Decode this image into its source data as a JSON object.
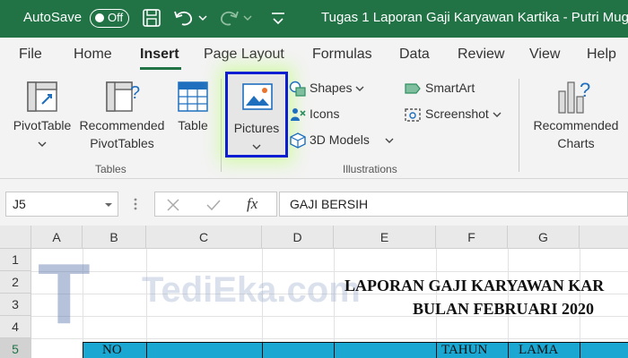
{
  "titlebar": {
    "autosave_label": "AutoSave",
    "autosave_state": "Off",
    "document_title": "Tugas 1 Laporan Gaji Karyawan Kartika - Putri Mugn"
  },
  "tabs": [
    "File",
    "Home",
    "Insert",
    "Page Layout",
    "Formulas",
    "Data",
    "Review",
    "View",
    "Help"
  ],
  "active_tab": "Insert",
  "ribbon": {
    "tables": {
      "pivottable": "PivotTable",
      "recommended_pivot_line1": "Recommended",
      "recommended_pivot_line2": "PivotTables",
      "table": "Table",
      "group_label": "Tables"
    },
    "illustrations": {
      "pictures": "Pictures",
      "shapes": "Shapes",
      "icons": "Icons",
      "models_3d": "3D Models",
      "smartart": "SmartArt",
      "screenshot": "Screenshot",
      "group_label": "Illustrations"
    },
    "charts": {
      "recommended_line1": "Recommended",
      "recommended_line2": "Charts"
    }
  },
  "formula_bar": {
    "name_box": "J5",
    "fx": "fx",
    "formula": "GAJI BERSIH"
  },
  "grid": {
    "columns": [
      "A",
      "B",
      "C",
      "D",
      "E",
      "F",
      "G"
    ],
    "rows": [
      "1",
      "2",
      "3",
      "4",
      "5"
    ],
    "heading_line1": "LAPORAN GAJI KARYAWAN KAR",
    "heading_line2": "BULAN FEBRUARI 2020",
    "header_no": "NO",
    "header_tahun": "TAHUN",
    "header_lama": "LAMA"
  },
  "watermark": {
    "letter": "T",
    "text": "TediEka.com"
  },
  "colors": {
    "titlebar": "#217346",
    "highlight_border": "#0d1dd3",
    "table_header_fill": "#1aa7d2"
  }
}
